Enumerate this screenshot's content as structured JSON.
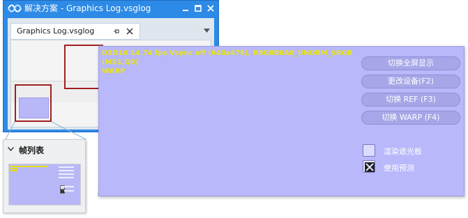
{
  "window": {
    "title": "解决方案 - Graphics Log.vsglog",
    "app_icon": "visual-studio-icon",
    "controls": [
      "minimize-icon",
      "maximize-icon",
      "close-icon"
    ]
  },
  "document": {
    "tab_label": "Graphics Log.vsglog",
    "tab_icons": [
      "pin-icon",
      "close-icon"
    ],
    "overflow_icon": "chevron-down-icon"
  },
  "frame_list": {
    "title": "帧列表",
    "toggle_icon": "chevron-down-icon"
  },
  "d3d_app": {
    "overlay": {
      "line1": "D3D10 14.74 fps Vsync off (640x478), R8G8B8A8_UNORM_SRGB",
      "line2": "(MS1,Q0)",
      "line3": "WARP"
    },
    "buttons": {
      "fullscreen": "切换全屏显示",
      "change_device": "更改设备(F2)",
      "toggle_ref": "切换 REF (F3)",
      "toggle_warp": "切换 WARP (F4)"
    },
    "checkboxes": {
      "hud_label": "渲染遮光板",
      "hud_checked": false,
      "predicate_label": "使用预测",
      "predicate_checked": true
    }
  },
  "colors": {
    "accent": "#2d8ae6",
    "app_background": "#b8b8fa",
    "overlay_text": "#e9e417",
    "highlight_border": "#a02020"
  }
}
